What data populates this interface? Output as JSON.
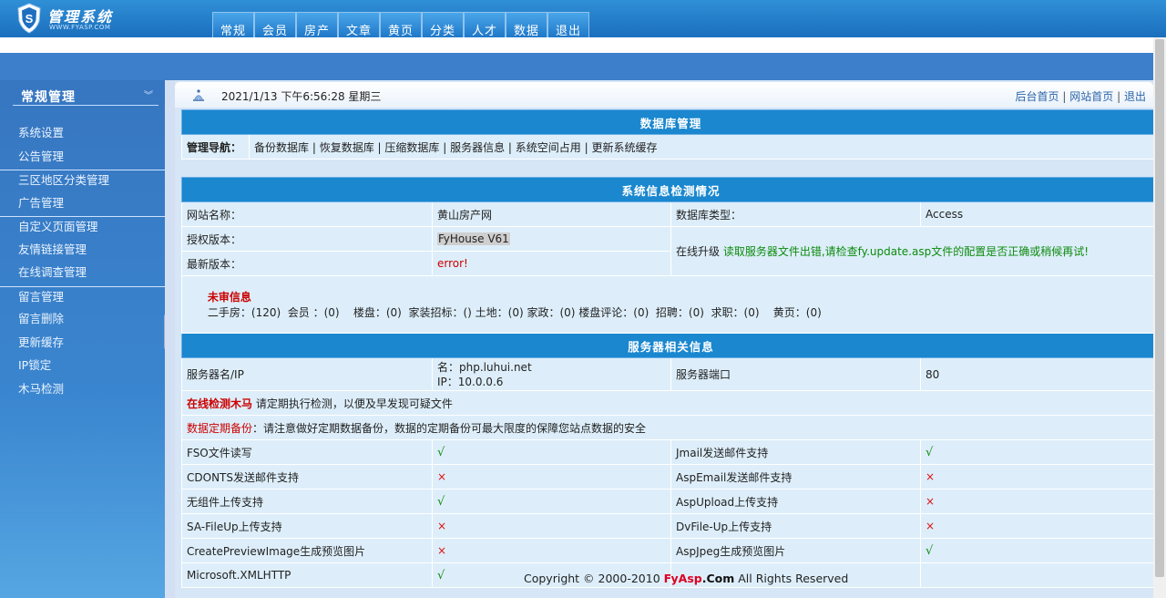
{
  "header": {
    "logo_title": "管理系统",
    "logo_sub": "WWW.FYASP.COM",
    "tabs": [
      "常规",
      "会员",
      "房产",
      "文章",
      "黄页",
      "分类",
      "人才",
      "数据",
      "退出"
    ]
  },
  "sidebar": {
    "title": "常规管理",
    "items": [
      "系统设置",
      "公告管理",
      "三区地区分类管理",
      "广告管理",
      "自定义页面管理",
      "友情链接管理",
      "在线调查管理",
      "留言管理",
      "留言删除",
      "更新缓存",
      "IP锁定",
      "木马检测"
    ]
  },
  "status": {
    "datetime": "2021/1/13 下午6:56:28 星期三",
    "links": [
      "后台首页",
      "网站首页",
      "退出"
    ],
    "separator": "|"
  },
  "db": {
    "title": "数据库管理",
    "nav_label": "管理导航：",
    "nav_links": [
      "备份数据库",
      "恢复数据库",
      "压缩数据库",
      "服务器信息",
      "系统空间占用",
      "更新系统缓存"
    ]
  },
  "sys": {
    "title": "系统信息检测情况",
    "site_name_label": "网站名称：",
    "site_name": "黄山房产网",
    "db_type_label": "数据库类型：",
    "db_type": "Access",
    "license_label": "授权版本：",
    "license": "FyHouse V61",
    "latest_label": "最新版本：",
    "latest": "error!",
    "upgrade_label": "在线升级",
    "upgrade_msg": "读取服务器文件出错,请检查fy.update.asp文件的配置是否正确或稍候再试!",
    "pending_label": "未审信息",
    "pending_text": "二手房：(120)  会员 ：(0)    楼盘：(0)  家装招标：() 土地：(0) 家政：(0) 楼盘评论：(0)  招聘：(0)  求职：(0)    黄页：(0)",
    "server_title": "服务器相关信息",
    "server_name_label": "服务器名/IP",
    "server_name": "名：php.luhui.net",
    "server_ip": "IP：10.0.0.6",
    "port_label": "服务器端口",
    "port": "80",
    "trojan_label": "在线检测木马",
    "trojan_text": "请定期执行检测，以便及早发现可疑文件",
    "backup_label": "数据定期备份",
    "backup_text": "：请注意做好定期数据备份，数据的定期备份可最大限度的保障您站点数据的安全",
    "components": [
      [
        "FSO文件读写",
        "√",
        "Jmail发送邮件支持",
        "√"
      ],
      [
        "CDONTS发送邮件支持",
        "×",
        "AspEmail发送邮件支持",
        "×"
      ],
      [
        "无组件上传支持",
        "√",
        "AspUpload上传支持",
        "×"
      ],
      [
        "SA-FileUp上传支持",
        "×",
        "DvFile-Up上传支持",
        "×"
      ],
      [
        "CreatePreviewImage生成预览图片",
        "×",
        "AspJpeg生成预览图片",
        "√"
      ],
      [
        "Microsoft.XMLHTTP",
        "√",
        "",
        ""
      ]
    ]
  },
  "footer": {
    "prefix": "Copyright © 2000-2010 ",
    "brand": "FyAsp",
    "brand2": ".Com",
    "suffix": " All Rights Reserved"
  }
}
